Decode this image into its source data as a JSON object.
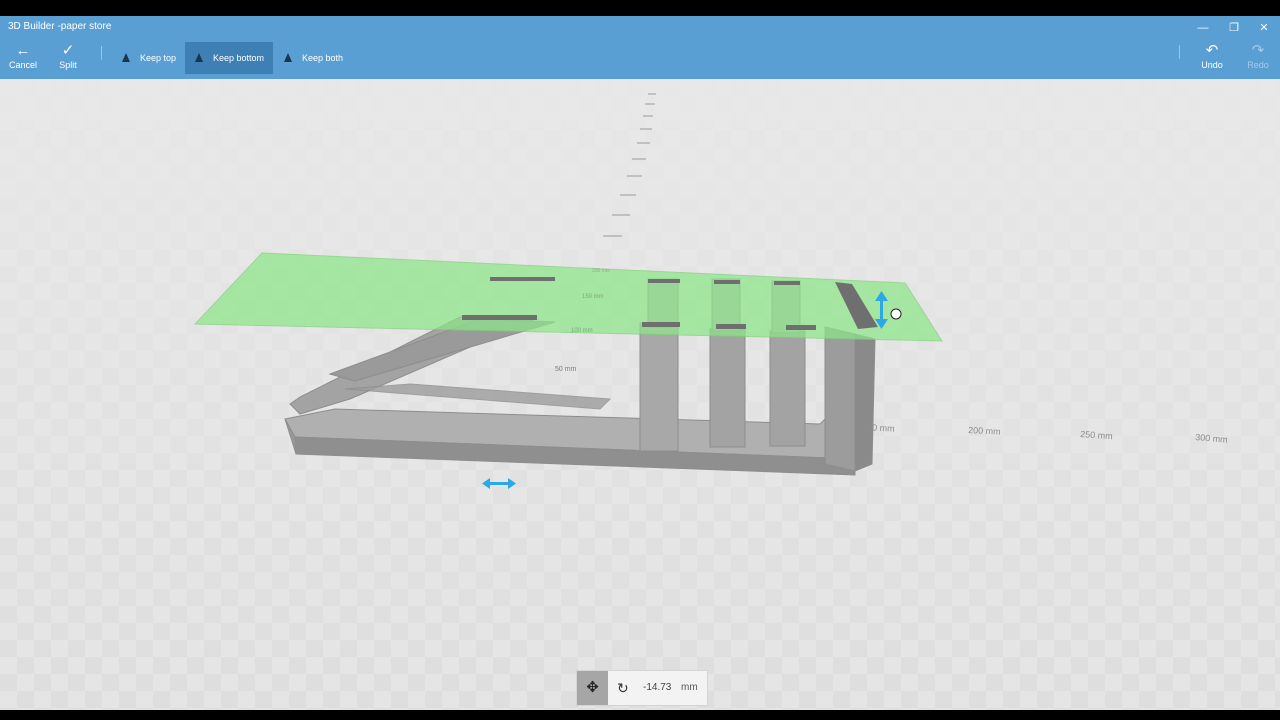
{
  "window": {
    "title": "3D Builder -paper store"
  },
  "window_controls": {
    "minimize": "—",
    "restore": "❐",
    "close": "✕"
  },
  "toolbar": {
    "cancel_label": "Cancel",
    "split_label": "Split",
    "keep_top_label": "Keep top",
    "keep_bottom_label": "Keep bottom",
    "keep_both_label": "Keep both",
    "undo_label": "Undo",
    "redo_label": "Redo",
    "active_mode": "Keep bottom"
  },
  "icons": {
    "back": "←",
    "check": "✓",
    "undo": "↶",
    "redo": "↷",
    "move": "✥",
    "rotate": "↻"
  },
  "scene": {
    "axis_labels_x": [
      "150 mm",
      "200 mm",
      "250 mm",
      "300 mm"
    ],
    "axis_labels_z": [
      "50 mm",
      "100 mm",
      "150 mm",
      "200 mm"
    ],
    "cut_plane_color": "#8ee68a",
    "model_color": "#a3a3a3",
    "accent_color": "#2aa9e6"
  },
  "dimension": {
    "value": "-14.73",
    "unit": "mm"
  }
}
